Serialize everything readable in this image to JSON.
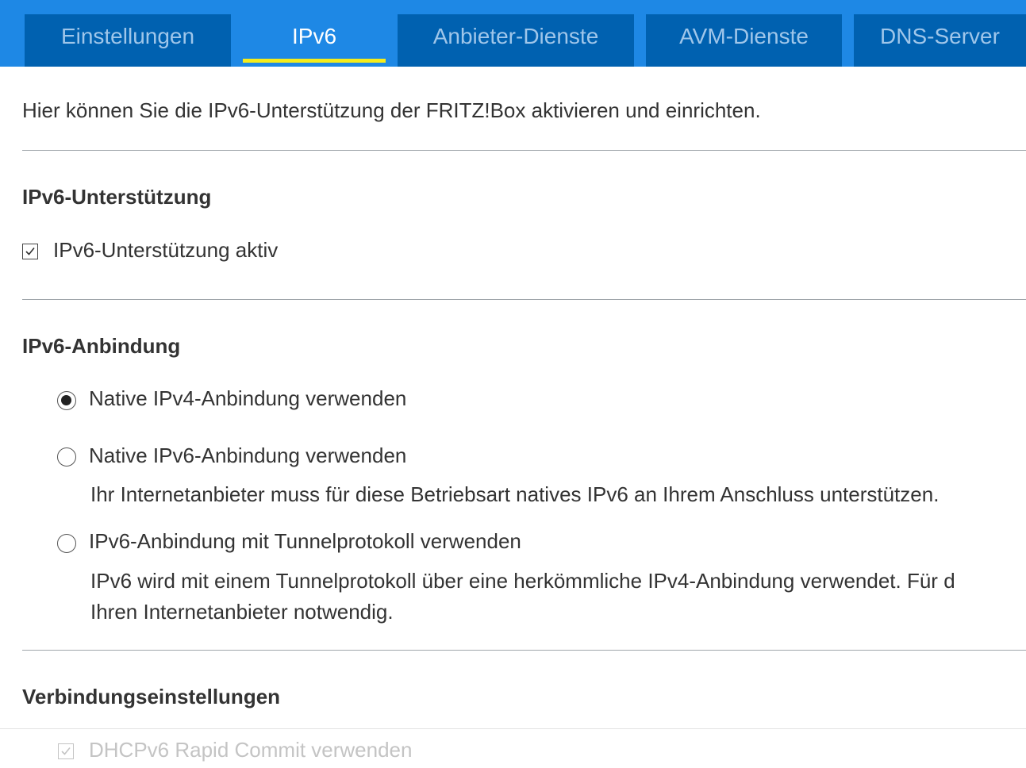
{
  "tabs": [
    {
      "label": "Einstellungen",
      "active": false
    },
    {
      "label": "IPv6",
      "active": true
    },
    {
      "label": "Anbieter-Dienste",
      "active": false
    },
    {
      "label": "AVM-Dienste",
      "active": false
    },
    {
      "label": "DNS-Server",
      "active": false
    }
  ],
  "intro": "Hier können Sie die IPv6-Unterstützung der FRITZ!Box aktivieren und einrichten.",
  "support": {
    "title": "IPv6-Unterstützung",
    "checkbox_label": "IPv6-Unterstützung aktiv",
    "checked": true
  },
  "connection": {
    "title": "IPv6-Anbindung",
    "options": [
      {
        "label": "Native IPv4-Anbindung verwenden",
        "selected": true
      },
      {
        "label": "Native IPv6-Anbindung verwenden",
        "selected": false,
        "help": "Ihr Internetanbieter muss für diese Betriebsart natives IPv6 an Ihrem Anschluss unterstützen."
      },
      {
        "label": "IPv6-Anbindung mit Tunnelprotokoll verwenden",
        "selected": false,
        "help_line1": "IPv6 wird mit einem Tunnelprotokoll über eine herkömmliche IPv4-Anbindung verwendet. Für d",
        "help_line2": "Ihren Internetanbieter notwendig."
      }
    ]
  },
  "settings": {
    "title": "Verbindungseinstellungen",
    "rapid_commit_label": "DHCPv6 Rapid Commit verwenden",
    "rapid_commit_checked": true,
    "rapid_commit_disabled": true
  },
  "colors": {
    "tabbar": "#1e88e5",
    "tab_inactive": "#0061b0",
    "active_underline": "#f5ec1b"
  }
}
